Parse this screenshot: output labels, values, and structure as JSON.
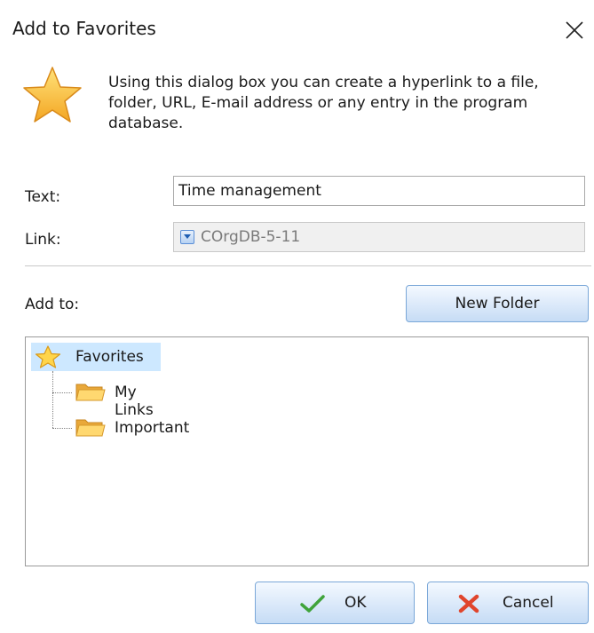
{
  "dialog": {
    "title": "Add to Favorites",
    "intro": "Using this dialog box  you can create a hyperlink to a file, folder, URL, E-mail address or any entry in the program database."
  },
  "form": {
    "text_label": "Text:",
    "text_value": "Time management",
    "link_label": "Link:",
    "link_value": "COrgDB-5-11",
    "add_to_label": "Add to:",
    "new_folder_label": "New Folder"
  },
  "tree": {
    "root": {
      "label": "Favorites",
      "icon": "star-icon",
      "selected": true
    },
    "children": [
      {
        "label": "My Links",
        "icon": "folder-icon"
      },
      {
        "label": "Important",
        "icon": "folder-icon"
      }
    ]
  },
  "buttons": {
    "ok_label": "OK",
    "cancel_label": "Cancel"
  },
  "colors": {
    "accent": "#c6dcf5",
    "selection": "#cde8ff",
    "star": "#f7b733",
    "folder": "#f6c64a"
  }
}
